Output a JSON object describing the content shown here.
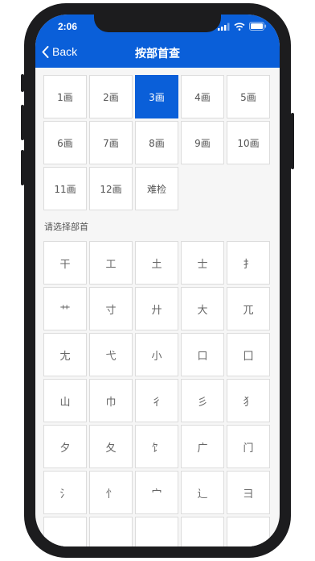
{
  "status_bar": {
    "time": "2:06"
  },
  "nav": {
    "back_label": "Back",
    "title": "按部首查"
  },
  "stroke_counts": {
    "items": [
      "1画",
      "2画",
      "3画",
      "4画",
      "5画",
      "6画",
      "7画",
      "8画",
      "9画",
      "10画",
      "11画",
      "12画",
      "难检"
    ],
    "selected": "3画"
  },
  "section_label": "请选择部首",
  "radicals": [
    "干",
    "工",
    "土",
    "士",
    "扌",
    "艹",
    "寸",
    "廾",
    "大",
    "兀",
    "尢",
    "弋",
    "小",
    "口",
    "囗",
    "山",
    "巾",
    "彳",
    "彡",
    "犭",
    "夕",
    "夂",
    "饣",
    "广",
    "门",
    "氵",
    "忄",
    "宀",
    "辶",
    "彐",
    "",
    "",
    "",
    "",
    ""
  ],
  "colors": {
    "accent": "#0a5fd9",
    "background": "#f6f6f6"
  }
}
